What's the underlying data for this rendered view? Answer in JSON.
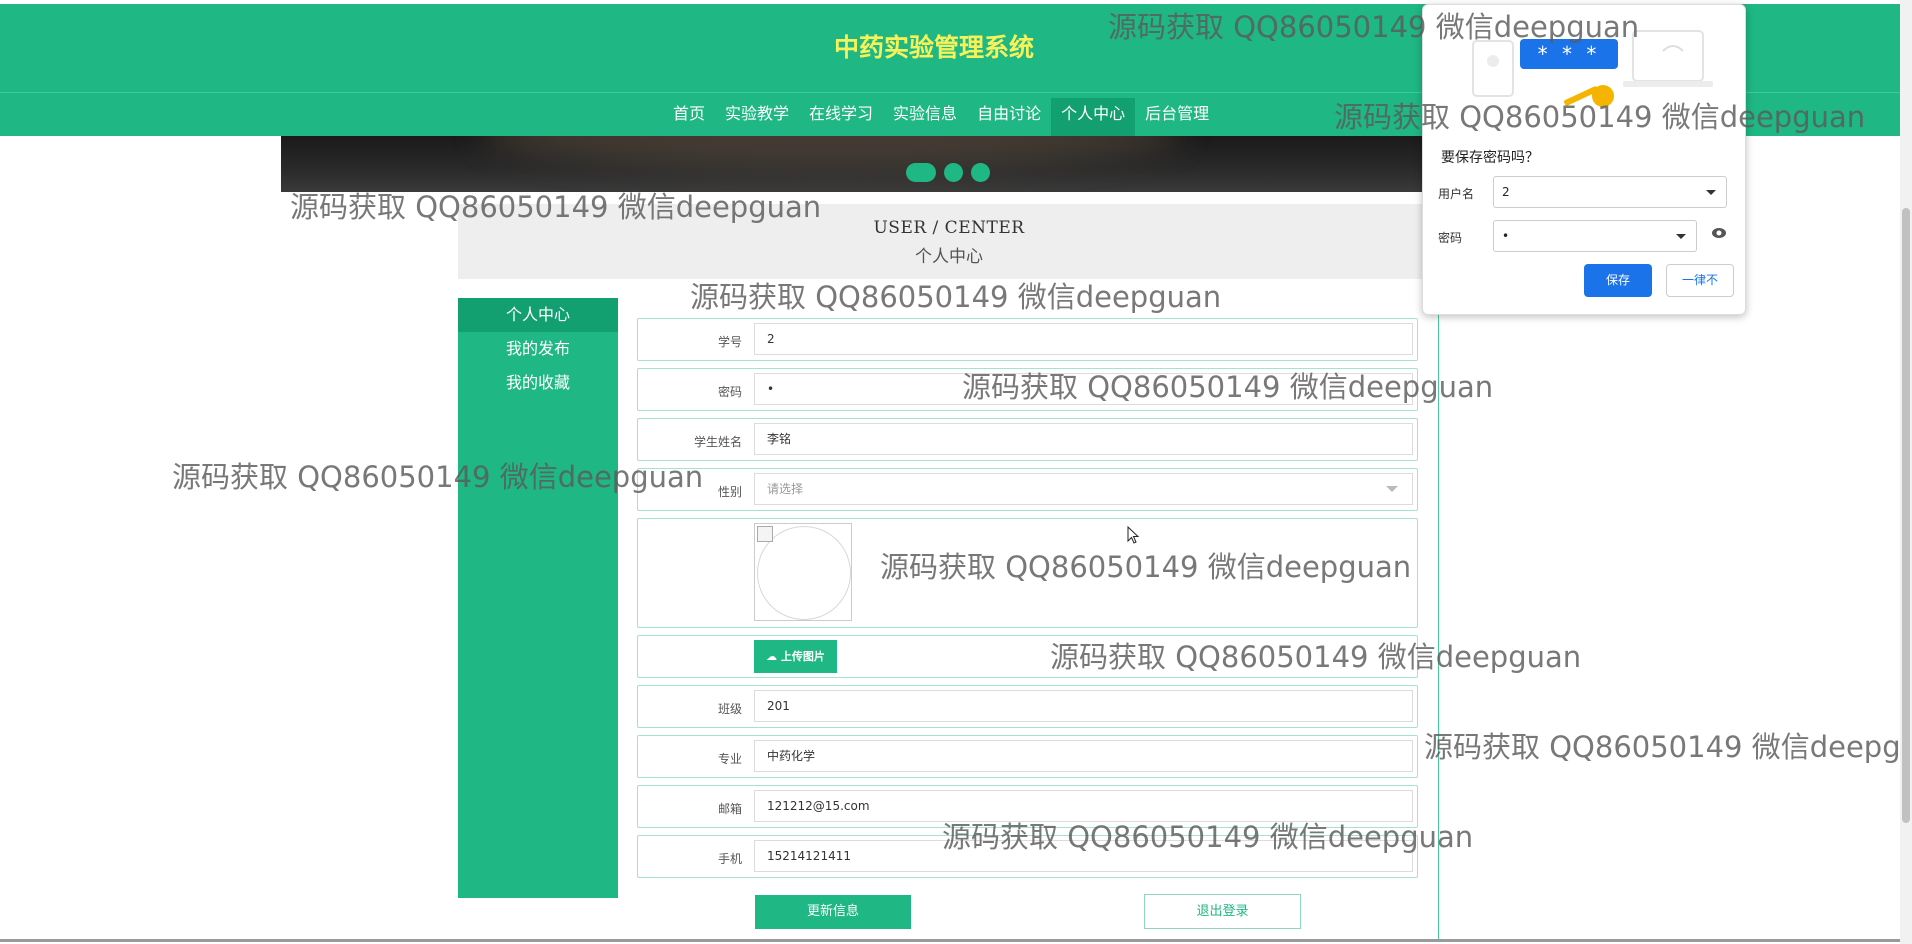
{
  "header": {
    "title": "中药实验管理系统"
  },
  "nav": {
    "items": [
      {
        "label": "首页"
      },
      {
        "label": "实验教学"
      },
      {
        "label": "在线学习"
      },
      {
        "label": "实验信息"
      },
      {
        "label": "自由讨论"
      },
      {
        "label": "个人中心",
        "active": true
      },
      {
        "label": "后台管理"
      }
    ]
  },
  "page_title": {
    "en": "USER / CENTER",
    "cn": "个人中心"
  },
  "sidebar": {
    "items": [
      {
        "label": "个人中心",
        "active": true
      },
      {
        "label": "我的发布"
      },
      {
        "label": "我的收藏"
      }
    ]
  },
  "form": {
    "student_id": {
      "label": "学号",
      "value": "2"
    },
    "password": {
      "label": "密码",
      "value": "•"
    },
    "name": {
      "label": "学生姓名",
      "value": "李铭"
    },
    "gender": {
      "label": "性别",
      "placeholder": "请选择"
    },
    "upload": {
      "label": "上传图片"
    },
    "class": {
      "label": "班级",
      "value": "201"
    },
    "major": {
      "label": "专业",
      "value": "中药化学"
    },
    "email": {
      "label": "邮箱",
      "value": "121212@15.com"
    },
    "phone": {
      "label": "手机",
      "value": "15214121411"
    }
  },
  "actions": {
    "update": "更新信息",
    "logout": "退出登录"
  },
  "password_popup": {
    "bubble": "* * *",
    "title": "要保存密码吗？",
    "username_label": "用户名",
    "username_value": "2",
    "password_label": "密码",
    "password_value": "•",
    "save": "保存",
    "never": "一律不"
  },
  "watermark": "源码获取 QQ86050149 微信deepguan",
  "colors": {
    "primary": "#1fb784",
    "active": "#12a070",
    "title": "#f6f25a",
    "popup_button": "#1a73e8"
  }
}
